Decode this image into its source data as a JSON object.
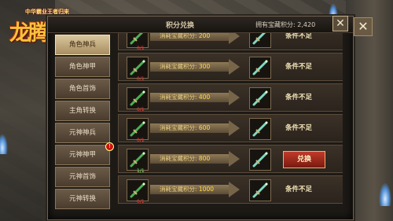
{
  "logo": {
    "subtitle": "中华霸业王者归来",
    "title": "龙腾传世"
  },
  "header": {
    "title": "积分兑换",
    "points_label": "拥有宝藏积分:",
    "points_value": "2,420",
    "close_glyph": "✕"
  },
  "outer_close_glyph": "✕",
  "menu": [
    {
      "label": "角色神兵",
      "active": true
    },
    {
      "label": "角色神甲",
      "active": false
    },
    {
      "label": "角色首饰",
      "active": false
    },
    {
      "label": "主角转换",
      "active": false
    },
    {
      "label": "元神神兵",
      "active": false
    },
    {
      "label": "元神神甲",
      "active": false,
      "badge": "!"
    },
    {
      "label": "元神首饰",
      "active": false
    },
    {
      "label": "元神转换",
      "active": false
    }
  ],
  "cost_prefix": "消耗宝藏积分:",
  "rows": [
    {
      "count": "0/1",
      "cost": "200",
      "status": "条件不足",
      "can_exchange": false
    },
    {
      "count": "0/1",
      "cost": "300",
      "status": "条件不足",
      "can_exchange": false
    },
    {
      "count": "0/1",
      "cost": "400",
      "status": "条件不足",
      "can_exchange": false
    },
    {
      "count": "0/1",
      "cost": "600",
      "status": "条件不足",
      "can_exchange": false
    },
    {
      "count": "1/1",
      "cost": "800",
      "status": "兑换",
      "can_exchange": true
    },
    {
      "count": "0/1",
      "cost": "1000",
      "status": "条件不足",
      "can_exchange": false
    }
  ],
  "colors": {
    "accent": "#ffd84b",
    "exchange": "#c03b2a",
    "menu_active": "#d9c69c"
  }
}
